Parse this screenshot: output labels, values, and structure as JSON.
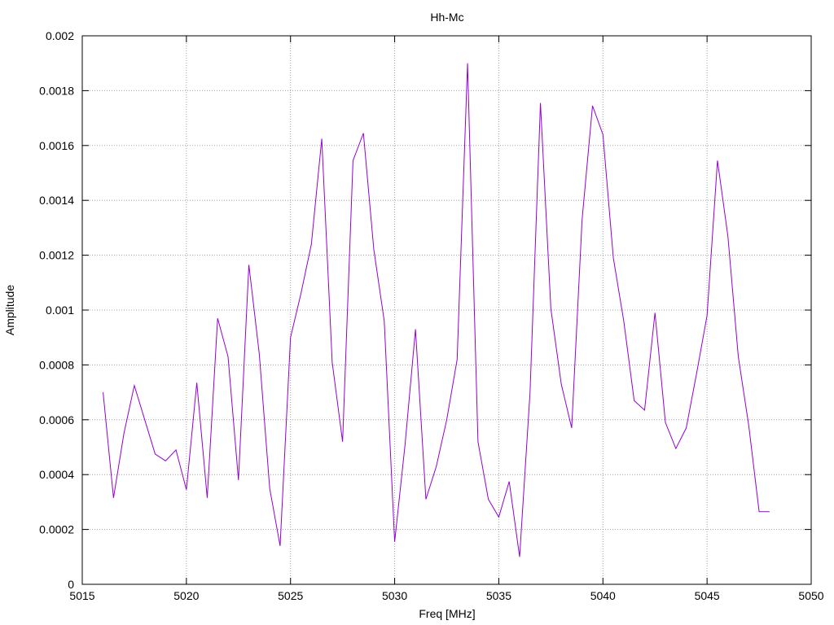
{
  "chart_data": {
    "type": "line",
    "title": "Hh-Mc",
    "xlabel": "Freq [MHz]",
    "ylabel": "Amplitude",
    "xlim": [
      5015,
      5050
    ],
    "ylim": [
      0,
      0.002
    ],
    "x_ticks": [
      5015,
      5020,
      5025,
      5030,
      5035,
      5040,
      5045,
      5050
    ],
    "x_tick_labels": [
      "5015",
      "5020",
      "5025",
      "5030",
      "5035",
      "5040",
      "5045",
      "5050"
    ],
    "y_ticks": [
      0,
      0.0002,
      0.0004,
      0.0006,
      0.0008,
      0.001,
      0.0012,
      0.0014,
      0.0016,
      0.0018,
      0.002
    ],
    "y_tick_labels": [
      "0",
      "0.0002",
      "0.0004",
      "0.0006",
      "0.0008",
      "0.001",
      "0.0012",
      "0.0014",
      "0.0016",
      "0.0018",
      "0.002"
    ],
    "grid": true,
    "grid_style": "dotted",
    "series": [
      {
        "color": "#9400d3",
        "x": [
          5016,
          5016.5,
          5017,
          5017.5,
          5018,
          5018.5,
          5019,
          5019.5,
          5020,
          5020.5,
          5021,
          5021.5,
          5022,
          5022.5,
          5023,
          5023.5,
          5024,
          5024.5,
          5025,
          5025.5,
          5026,
          5026.5,
          5027,
          5027.5,
          5028,
          5028.5,
          5029,
          5029.5,
          5030,
          5030.5,
          5031,
          5031.5,
          5032,
          5032.5,
          5033,
          5033.5,
          5034,
          5034.5,
          5035,
          5035.5,
          5036,
          5036.5,
          5037,
          5037.5,
          5038,
          5038.5,
          5039,
          5039.5,
          5040,
          5040.5,
          5041,
          5041.5,
          5042,
          5042.5,
          5043,
          5043.5,
          5044,
          5044.5,
          5045,
          5045.5,
          5046,
          5046.5,
          5047,
          5047.5,
          5048
        ],
        "y": [
          0.0007,
          0.000315,
          0.00055,
          0.000725,
          0.0006,
          0.000475,
          0.00045,
          0.00049,
          0.000345,
          0.000735,
          0.000315,
          0.00097,
          0.00083,
          0.00038,
          0.001165,
          0.00084,
          0.00035,
          0.00014,
          0.0009,
          0.00106,
          0.00124,
          0.001625,
          0.00081,
          0.00052,
          0.001545,
          0.001645,
          0.00122,
          0.00096,
          0.000155,
          0.00051,
          0.00093,
          0.00031,
          0.00043,
          0.0006,
          0.00082,
          0.0019,
          0.00052,
          0.00031,
          0.000245,
          0.000375,
          0.0001,
          0.0007,
          0.001755,
          0.001005,
          0.00073,
          0.00057,
          0.00133,
          0.001745,
          0.00164,
          0.00119,
          0.00096,
          0.00067,
          0.000635,
          0.00099,
          0.00059,
          0.000495,
          0.00057,
          0.00077,
          0.00098,
          0.001545,
          0.00127,
          0.00083,
          0.00058,
          0.000265,
          0.000265
        ]
      }
    ]
  }
}
